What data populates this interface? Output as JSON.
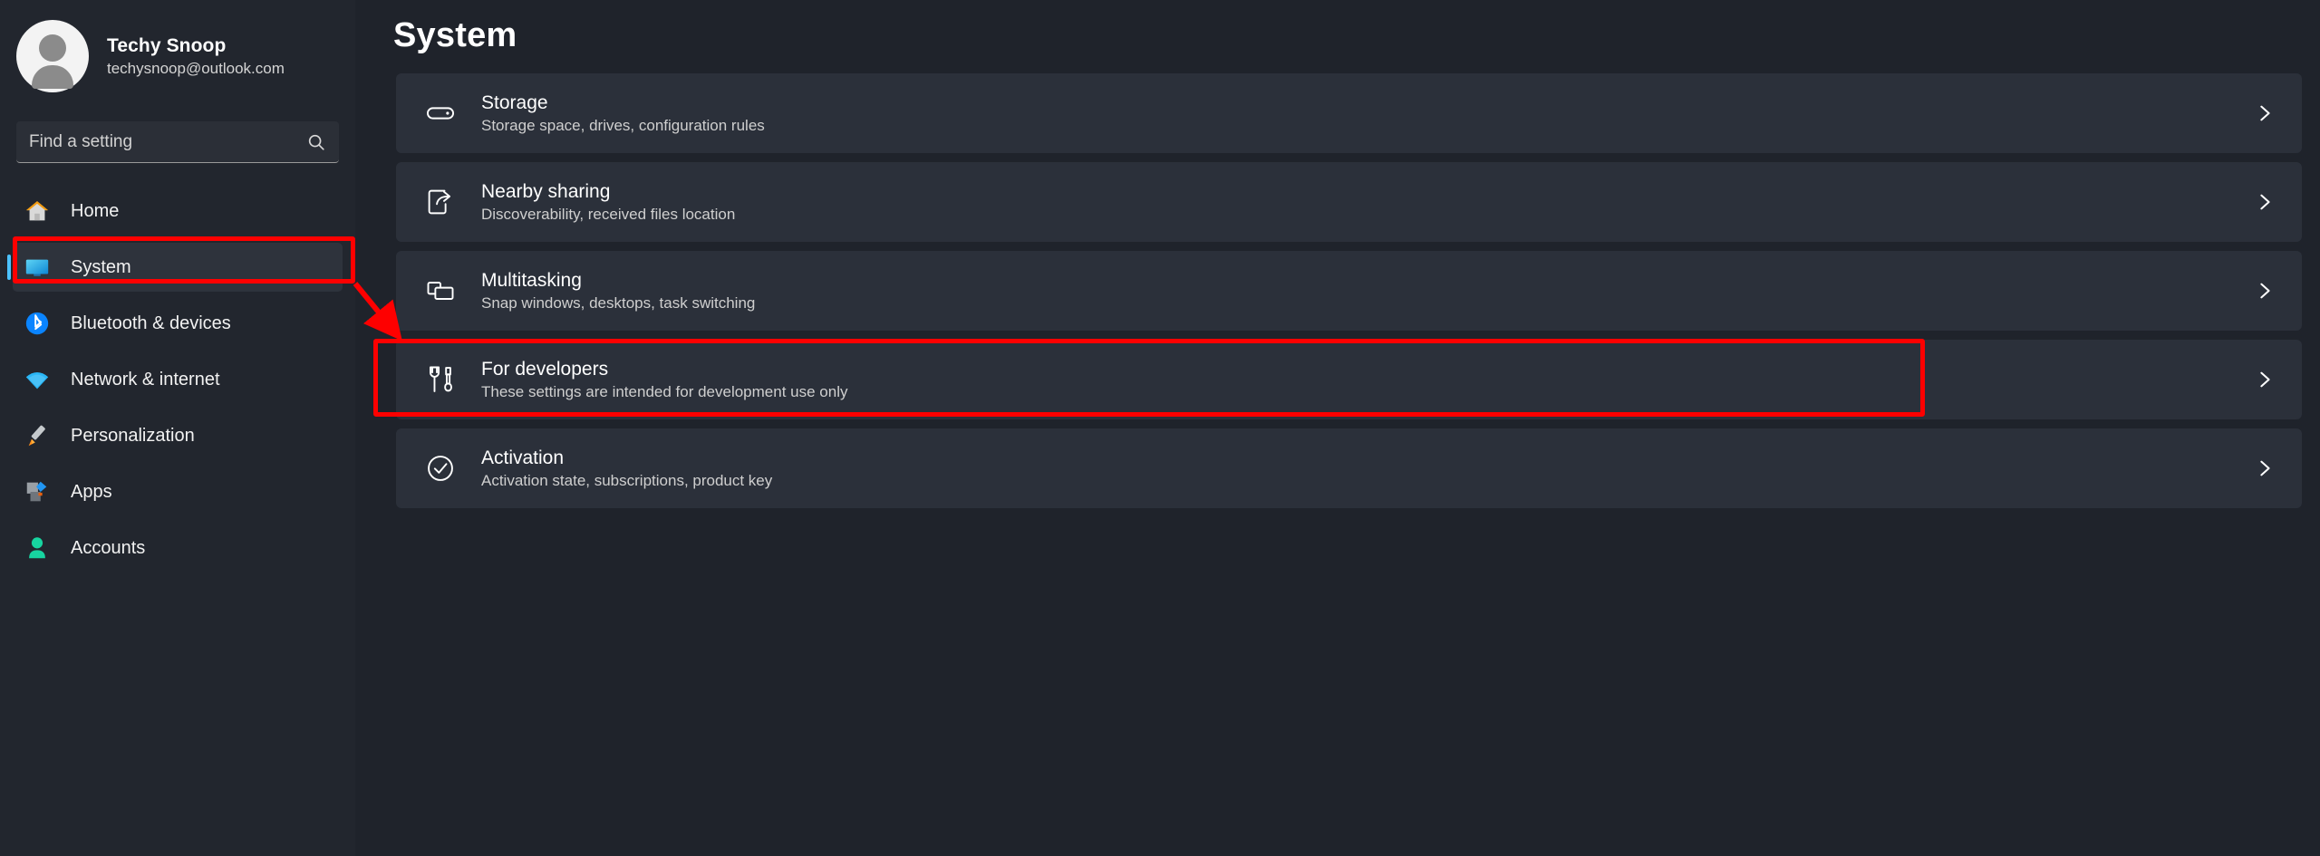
{
  "account": {
    "name": "Techy Snoop",
    "email": "techysnoop@outlook.com",
    "avatar_icon": "person-avatar-icon"
  },
  "search": {
    "placeholder": "Find a setting",
    "value": "",
    "icon": "search-icon"
  },
  "sidebar": {
    "items": [
      {
        "label": "Home",
        "icon": "home-icon",
        "selected": false
      },
      {
        "label": "System",
        "icon": "monitor-icon",
        "selected": true
      },
      {
        "label": "Bluetooth & devices",
        "icon": "bluetooth-icon",
        "selected": false
      },
      {
        "label": "Network & internet",
        "icon": "wifi-icon",
        "selected": false
      },
      {
        "label": "Personalization",
        "icon": "paintbrush-icon",
        "selected": false
      },
      {
        "label": "Apps",
        "icon": "apps-blocks-icon",
        "selected": false
      },
      {
        "label": "Accounts",
        "icon": "person-icon",
        "selected": false
      }
    ]
  },
  "main": {
    "title": "System",
    "cards": [
      {
        "title": "Storage",
        "subtitle": "Storage space, drives, configuration rules",
        "icon": "harddrive-icon",
        "chevron": "chevron-right-icon",
        "highlighted": false
      },
      {
        "title": "Nearby sharing",
        "subtitle": "Discoverability, received files location",
        "icon": "share-icon",
        "chevron": "chevron-right-icon",
        "highlighted": false
      },
      {
        "title": "Multitasking",
        "subtitle": "Snap windows, desktops, task switching",
        "icon": "windows-stack-icon",
        "chevron": "chevron-right-icon",
        "highlighted": false
      },
      {
        "title": "For developers",
        "subtitle": "These settings are intended for development use only",
        "icon": "tools-wrench-screwdriver-icon",
        "chevron": "chevron-right-icon",
        "highlighted": true
      },
      {
        "title": "Activation",
        "subtitle": "Activation state, subscriptions, product key",
        "icon": "check-circle-icon",
        "chevron": "chevron-right-icon",
        "highlighted": false
      }
    ]
  },
  "annotations": {
    "highlight_color": "#fe0000",
    "selection_accent": "#4cc2ff",
    "boxes": [
      "sidebar-item-system",
      "card-for-developers"
    ],
    "arrow": "arrow-from-system-to-for-developers"
  }
}
